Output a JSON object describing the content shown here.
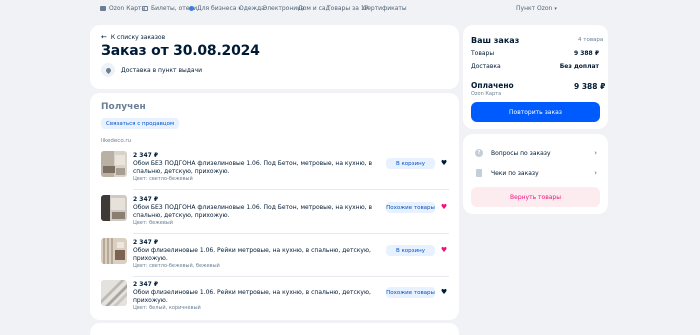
{
  "topnav": {
    "items": [
      {
        "label": "Ozon Карта",
        "icon": "card-icon"
      },
      {
        "label": "Билеты, отели",
        "icon": "ticket-icon"
      },
      {
        "label": "Для бизнеса",
        "icon": "business-icon"
      },
      {
        "label": "Одежда"
      },
      {
        "label": "Электроника"
      },
      {
        "label": "Дом и сад"
      },
      {
        "label": "Товары за 1₽"
      },
      {
        "label": "Сертификаты"
      }
    ],
    "pickup_point": "Пункт Ozon"
  },
  "order": {
    "back_label": "К списку заказов",
    "title": "Заказ от 30.08.2024",
    "delivery_label": "Доставка в пункт выдачи"
  },
  "shipment": {
    "status": "Получен",
    "contact_seller_label": "Связаться с продавцом",
    "seller": "likedeco.ru",
    "items": [
      {
        "price": "2 347 ₽",
        "name": "Обои БЕЗ ПОДГОНА флизелиновые 1.06. Под Бетон, метровые, на кухню, в спальню, детскую, прихожую.",
        "color": "Цвет: светло-бежевый",
        "action": "В корзину",
        "favorite": false
      },
      {
        "price": "2 347 ₽",
        "name": "Обои БЕЗ ПОДГОНА флизелиновые 1.06. Под Бетон, метровые, на кухню, в спальню, детскую, прихожую.",
        "color": "Цвет: бежевый",
        "action": "Похожие товары",
        "favorite": true
      },
      {
        "price": "2 347 ₽",
        "name": "Обои флизелиновые 1.06. Рейки метровые, на кухню, в спальню, детскую, прихожую.",
        "color": "Цвет: светло-бежевый, бежевый",
        "action": "В корзину",
        "favorite": true
      },
      {
        "price": "2 347 ₽",
        "name": "Обои флизелиновые 1.06. Рейки метровые, на кухню, в спальню, детскую, прихожую.",
        "color": "Цвет: белый, коричневый",
        "action": "Похожие товары",
        "favorite": false
      }
    ]
  },
  "summary": {
    "title": "Ваш заказ",
    "count": "4 товара",
    "goods_label": "Товары",
    "goods_value": "9 388 ₽",
    "delivery_label": "Доставка",
    "delivery_value": "Без доплат",
    "paid_label": "Оплачено",
    "paid_sub": "Ozon Карта",
    "paid_value": "9 388 ₽",
    "repeat_label": "Повторить заказ"
  },
  "actions": {
    "questions_label": "Вопросы по заказу",
    "receipts_label": "Чеки по заказу",
    "return_label": "Вернуть товары"
  },
  "colors": {
    "accent": "#005bff",
    "favorite_on": "#f1117e",
    "favorite_off": "#001a34",
    "background": "#f1f2f6"
  }
}
